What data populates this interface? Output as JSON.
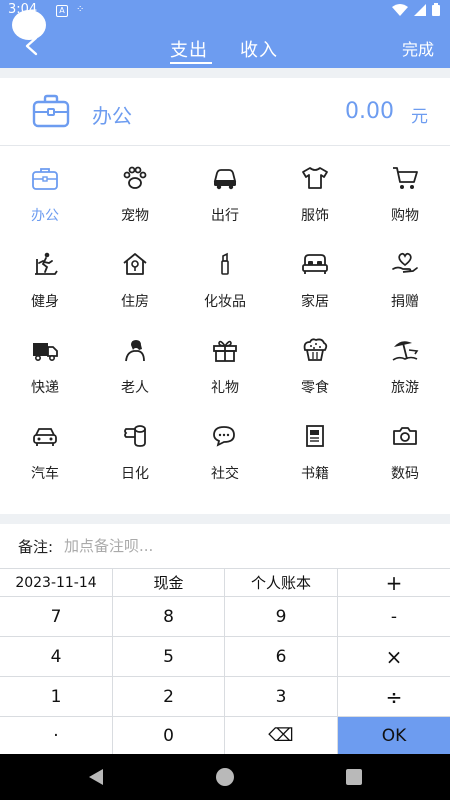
{
  "status_bar": {
    "time": "3:04",
    "indicator": "A"
  },
  "header": {
    "tabs": [
      {
        "label": "支出",
        "active": true
      },
      {
        "label": "收入",
        "active": false
      }
    ],
    "done_label": "完成",
    "accent_color": "#6d9cf0"
  },
  "selected": {
    "name": "办公",
    "amount": "0.00",
    "unit": "元",
    "icon": "briefcase-icon"
  },
  "categories": [
    {
      "label": "办公",
      "icon": "briefcase-icon",
      "active": true
    },
    {
      "label": "宠物",
      "icon": "paw-icon"
    },
    {
      "label": "出行",
      "icon": "car-front-icon"
    },
    {
      "label": "服饰",
      "icon": "shirt-icon"
    },
    {
      "label": "购物",
      "icon": "cart-icon"
    },
    {
      "label": "健身",
      "icon": "treadmill-icon"
    },
    {
      "label": "住房",
      "icon": "house-icon"
    },
    {
      "label": "化妆品",
      "icon": "lipstick-icon"
    },
    {
      "label": "家居",
      "icon": "bed-icon"
    },
    {
      "label": "捐赠",
      "icon": "donate-heart-icon"
    },
    {
      "label": "快递",
      "icon": "delivery-truck-icon"
    },
    {
      "label": "老人",
      "icon": "elder-icon"
    },
    {
      "label": "礼物",
      "icon": "gift-icon"
    },
    {
      "label": "零食",
      "icon": "muffin-icon"
    },
    {
      "label": "旅游",
      "icon": "beach-umbrella-icon"
    },
    {
      "label": "汽车",
      "icon": "car-icon"
    },
    {
      "label": "日化",
      "icon": "toilet-roll-icon"
    },
    {
      "label": "社交",
      "icon": "chat-bubbles-icon"
    },
    {
      "label": "书籍",
      "icon": "book-icon"
    },
    {
      "label": "数码",
      "icon": "camera-icon"
    }
  ],
  "note": {
    "label": "备注:",
    "placeholder": "加点备注呗..."
  },
  "keypad": {
    "date": "2023-11-14",
    "account": "现金",
    "book": "个人账本",
    "keys": [
      [
        "7",
        "8",
        "9",
        "-"
      ],
      [
        "4",
        "5",
        "6",
        "×"
      ],
      [
        "1",
        "2",
        "3",
        "÷"
      ],
      [
        "·",
        "0",
        "⌫",
        "OK"
      ]
    ],
    "plus": "+"
  }
}
